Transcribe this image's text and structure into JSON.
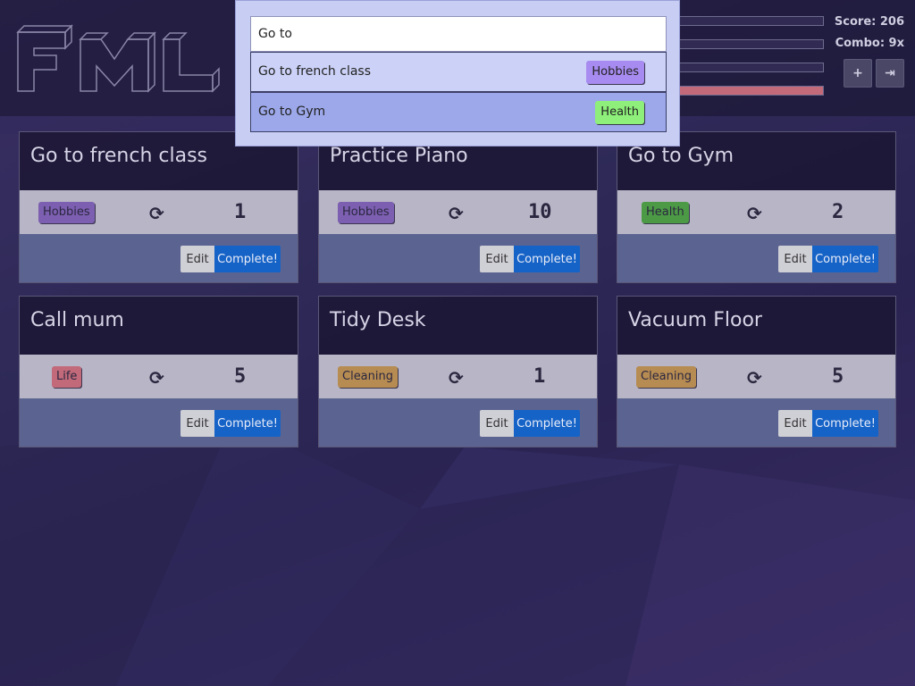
{
  "logo_text": "FML",
  "score": {
    "score_label": "Score: 206",
    "combo_label": "Combo: 9x"
  },
  "progress": [
    0.0,
    0.0,
    0.0,
    1.0
  ],
  "top_buttons": {
    "add_icon": "+",
    "logout_icon": "⇥"
  },
  "search": {
    "query": "Go to",
    "results": [
      {
        "label": "Go to french class",
        "tag": "Hobbies",
        "tag_color": "#a78bf0"
      },
      {
        "label": "Go to Gym",
        "tag": "Health",
        "tag_color": "#8ef07a"
      }
    ]
  },
  "cards": [
    {
      "title": "Go to french class",
      "tag": "Hobbies",
      "tag_color": "#7c5fb0",
      "count": "1",
      "edit": "Edit",
      "complete": "Complete!"
    },
    {
      "title": "Practice Piano",
      "tag": "Hobbies",
      "tag_color": "#7c5fb0",
      "count": "10",
      "edit": "Edit",
      "complete": "Complete!"
    },
    {
      "title": "Go to Gym",
      "tag": "Health",
      "tag_color": "#4c9a45",
      "count": "2",
      "edit": "Edit",
      "complete": "Complete!"
    },
    {
      "title": "Call mum",
      "tag": "Life",
      "tag_color": "#c26a7a",
      "count": "5",
      "edit": "Edit",
      "complete": "Complete!"
    },
    {
      "title": "Tidy Desk",
      "tag": "Cleaning",
      "tag_color": "#b78c52",
      "count": "1",
      "edit": "Edit",
      "complete": "Complete!"
    },
    {
      "title": "Vacuum Floor",
      "tag": "Cleaning",
      "tag_color": "#b78c52",
      "count": "5",
      "edit": "Edit",
      "complete": "Complete!"
    }
  ],
  "refresh_icon": "⟳"
}
